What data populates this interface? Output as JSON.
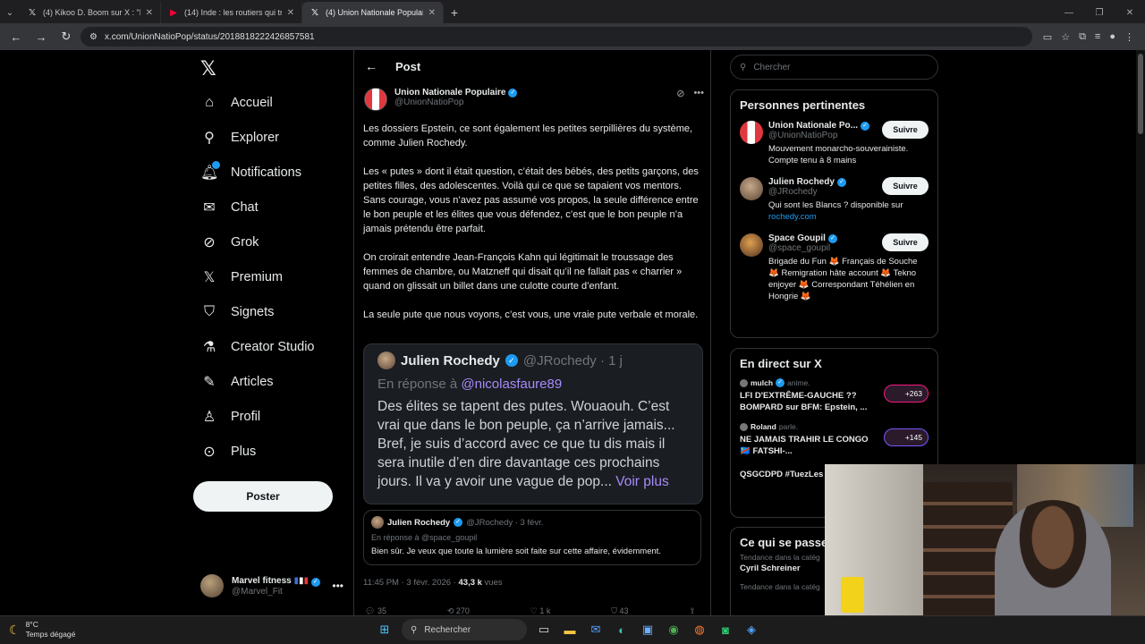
{
  "browser": {
    "tabs": [
      {
        "title": "(4) Kikoo D. Boom sur X : \"Les p",
        "icon": "x-logo"
      },
      {
        "title": "(14) Inde : les routiers qui trans",
        "icon": "youtube-logo"
      },
      {
        "title": "(4) Union Nationale Populaire s",
        "icon": "x-logo"
      }
    ],
    "url": "x.com/UnionNatioPop/status/2018818222426857581"
  },
  "nav": {
    "items": [
      {
        "label": "Accueil",
        "icon": "home-icon"
      },
      {
        "label": "Explorer",
        "icon": "search-icon"
      },
      {
        "label": "Notifications",
        "icon": "bell-icon"
      },
      {
        "label": "Chat",
        "icon": "mail-icon"
      },
      {
        "label": "Grok",
        "icon": "grok-icon"
      },
      {
        "label": "Premium",
        "icon": "x-logo-icon"
      },
      {
        "label": "Signets",
        "icon": "bookmark-icon"
      },
      {
        "label": "Creator Studio",
        "icon": "flask-icon"
      },
      {
        "label": "Articles",
        "icon": "article-icon"
      },
      {
        "label": "Profil",
        "icon": "person-icon"
      },
      {
        "label": "Plus",
        "icon": "more-circle-icon"
      }
    ],
    "post_button": "Poster",
    "account": {
      "name": "Marvel fitness",
      "handle": "@Marvel_Fit"
    }
  },
  "post": {
    "header": "Post",
    "author_name": "Union Nationale Populaire",
    "author_handle": "@UnionNatioPop",
    "paragraphs": [
      "Les dossiers Epstein, ce sont également les petites serpillières du système, comme Julien Rochedy.",
      "Les « putes » dont il était question, c’était des bébés, des petits garçons, des petites filles, des adolescentes. Voilà qui ce que se tapaient vos mentors. Sans courage, vous n’avez pas assumé vos propos, la seule différence entre le bon peuple et les élites que vous défendez, c’est que le bon peuple n’a jamais prétendu être parfait.",
      "On croirait entendre Jean-François Kahn qui légitimait le troussage des femmes de chambre, ou Matzneff qui disait qu’il ne fallait pas « charrier » quand on glissait un billet dans une culotte courte d’enfant.",
      "La seule pute que nous voyons, c’est vous, une vraie pute verbale et morale."
    ],
    "quote": {
      "name": "Julien Rochedy",
      "handle": "@JRochedy · 1 j",
      "reply_prefix": "En réponse à",
      "reply_to": "@nicolasfaure89",
      "text": "Des élites se tapent des putes. Wouaouh. C’est vrai que dans le bon peuple, ça n’arrive jamais... Bref, je suis d’accord avec ce que tu dis mais il sera inutile d’en dire davantage ces prochains jours. Il va y avoir une vague de pop...",
      "more": "Voir plus"
    },
    "quote2": {
      "name": "Julien Rochedy",
      "handle": "@JRochedy · 3 févr.",
      "reply": "En réponse à @space_goupil",
      "text": "Bien sûr. Je veux que toute la lumière soit faite sur cette affaire, évidemment."
    },
    "meta_time": "11:45 PM · 3 févr. 2026 · ",
    "meta_views": "43,3 k",
    "meta_views_label": " vues",
    "actions": [
      "35",
      "270",
      "1 k",
      "43"
    ]
  },
  "sidebar": {
    "search_placeholder": "Chercher",
    "people_title": "Personnes pertinentes",
    "follow_label": "Suivre",
    "people": [
      {
        "name": "Union Nationale Po...",
        "handle": "@UnionNatioPop",
        "bio": "Mouvement monarcho-souverainiste. Compte tenu à 8 mains"
      },
      {
        "name": "Julien Rochedy",
        "handle": "@JRochedy",
        "bio": "Qui sont les Blancs ? disponible sur ",
        "link": "rochedy.com"
      },
      {
        "name": "Space Goupil",
        "handle": "@space_goupil",
        "bio": "Brigade du Fun 🦊 Français de Souche 🦊 Remigration hâte account 🦊 Tekno enjoyer 🦊 Correspondant Téhélien en Hongrie 🦊"
      }
    ],
    "live_title": "En direct sur X",
    "live": [
      {
        "host": "mulch",
        "action": "anime.",
        "title": "LFI D'EXTRÊME-GAUCHE ?? BOMPARD sur BFM: Epstein, ...",
        "count": "+263"
      },
      {
        "host": "Roland",
        "action": "parle.",
        "title": "NE JAMAIS TRAHIR LE CONGO 🇨🇩 FATSHI-...",
        "count": "+145"
      },
      {
        "host": "",
        "action": "",
        "title": "QSGCDPD #TuezLes",
        "count": ""
      }
    ],
    "trends_title": "Ce qui se passe",
    "trend_label": "Tendance dans la catég",
    "trend_name": "Cyril Schreiner",
    "trend_label2": "Tendance dans la catég"
  },
  "taskbar": {
    "temp": "8°C",
    "weather": "Temps dégagé",
    "search": "Rechercher"
  },
  "colors": {
    "accent": "#1d9bf0",
    "live": "#f91880",
    "background": "#000000"
  }
}
